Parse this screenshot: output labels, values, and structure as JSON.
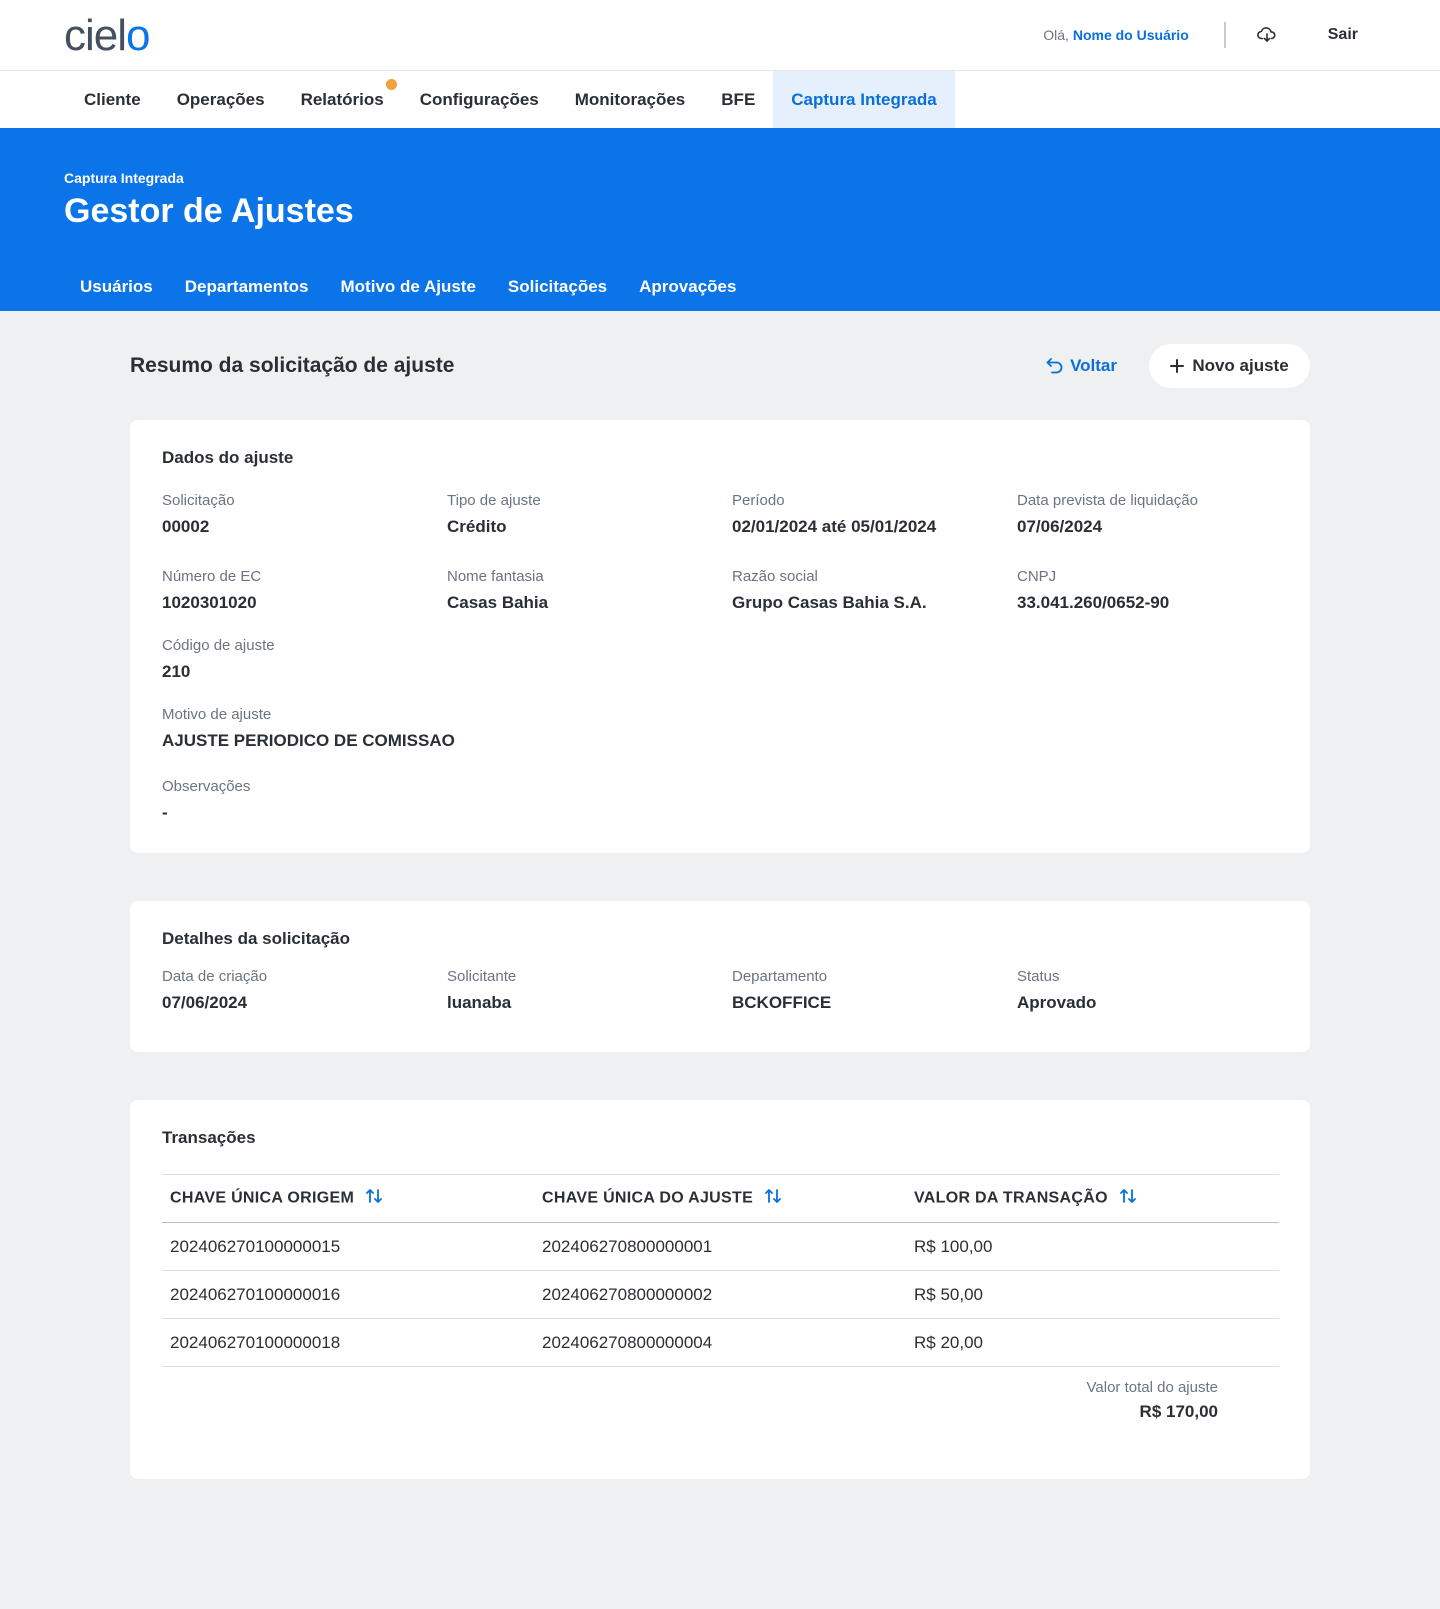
{
  "header": {
    "logo": "cielo",
    "greeting_prefix": "Olá,",
    "user_name": "Nome do Usuário",
    "logout_label": "Sair"
  },
  "main_nav": {
    "items": [
      {
        "label": "Cliente"
      },
      {
        "label": "Operações"
      },
      {
        "label": "Relatórios"
      },
      {
        "label": "Configurações"
      },
      {
        "label": "Monitorações"
      },
      {
        "label": "BFE"
      },
      {
        "label": "Captura Integrada"
      }
    ]
  },
  "hero": {
    "breadcrumb": "Captura Integrada",
    "title": "Gestor de Ajustes",
    "tabs": [
      {
        "label": "Usuários"
      },
      {
        "label": "Departamentos"
      },
      {
        "label": "Motivo de Ajuste"
      },
      {
        "label": "Solicitações"
      },
      {
        "label": "Aprovações"
      }
    ]
  },
  "page": {
    "title": "Resumo da solicitação de ajuste",
    "back_label": "Voltar",
    "new_label": "Novo ajuste"
  },
  "dados": {
    "title": "Dados do ajuste",
    "solicitacao": {
      "label": "Solicitação",
      "value": "00002"
    },
    "tipo": {
      "label": "Tipo de ajuste",
      "value": "Crédito"
    },
    "periodo": {
      "label": "Período",
      "value": "02/01/2024 até 05/01/2024"
    },
    "liquidacao": {
      "label": "Data prevista de liquidação",
      "value": "07/06/2024"
    },
    "ec": {
      "label": "Número de EC",
      "value": "1020301020"
    },
    "fantasia": {
      "label": "Nome fantasia",
      "value": "Casas Bahia"
    },
    "razao": {
      "label": "Razão social",
      "value": "Grupo Casas Bahia S.A."
    },
    "cnpj": {
      "label": "CNPJ",
      "value": "33.041.260/0652-90"
    },
    "codigo": {
      "label": "Código de ajuste",
      "value": "210"
    },
    "motivo": {
      "label": "Motivo de ajuste",
      "value": "AJUSTE PERIODICO DE COMISSAO"
    },
    "obs": {
      "label": "Observações",
      "value": "-"
    }
  },
  "detalhes": {
    "title": "Detalhes da solicitação",
    "criacao": {
      "label": "Data de criação",
      "value": "07/06/2024"
    },
    "solicitante": {
      "label": "Solicitante",
      "value": "luanaba"
    },
    "departamento": {
      "label": "Departamento",
      "value": "BCKOFFICE"
    },
    "status": {
      "label": "Status",
      "value": "Aprovado"
    }
  },
  "transacoes": {
    "title": "Transações",
    "columns": [
      "CHAVE ÚNICA ORIGEM",
      "CHAVE ÚNICA DO AJUSTE",
      "VALOR DA TRANSAÇÃO"
    ],
    "rows": [
      [
        "202406270100000015",
        "202406270800000001",
        "R$ 100,00"
      ],
      [
        "202406270100000016",
        "202406270800000002",
        "R$ 50,00"
      ],
      [
        "202406270100000018",
        "202406270800000004",
        "R$ 20,00"
      ]
    ],
    "total_label": "Valor total do ajuste",
    "total_value": "R$ 170,00"
  },
  "colors": {
    "brand_blue": "#0a74e8",
    "notification_dot": "#f5a03c",
    "background": "#eff0f2"
  }
}
